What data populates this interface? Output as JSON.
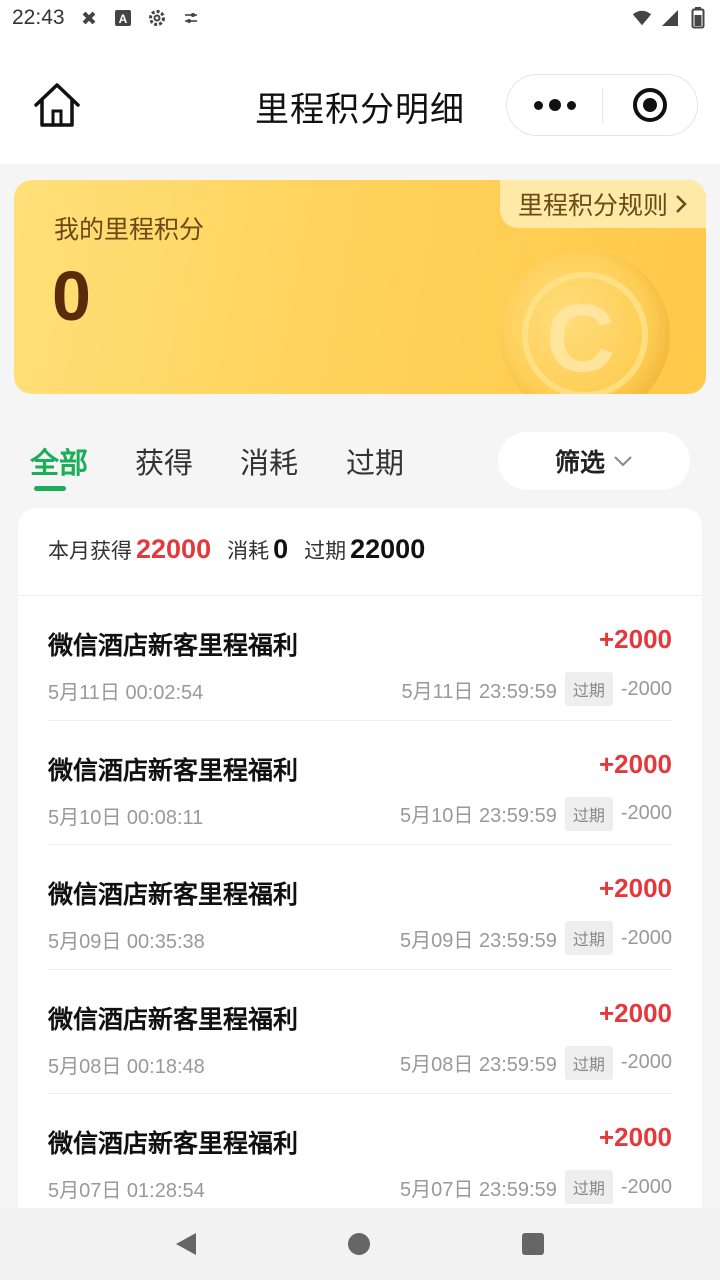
{
  "status_bar": {
    "time": "22:43"
  },
  "header": {
    "title": "里程积分明细"
  },
  "points_card": {
    "label": "我的里程积分",
    "value": "0",
    "rules_link": "里程积分规则"
  },
  "tabs": [
    {
      "label": "全部",
      "active": true
    },
    {
      "label": "获得",
      "active": false
    },
    {
      "label": "消耗",
      "active": false
    },
    {
      "label": "过期",
      "active": false
    }
  ],
  "filter": {
    "label": "筛选"
  },
  "summary": {
    "earned_label": "本月获得",
    "earned_value": "22000",
    "spent_label": "消耗",
    "spent_value": "0",
    "expired_label": "过期",
    "expired_value": "22000"
  },
  "records": [
    {
      "title": "微信酒店新客里程福利",
      "amount": "+2000",
      "time": "5月11日 00:02:54",
      "expire_time": "5月11日 23:59:59",
      "badge": "过期",
      "expire_amount": "-2000"
    },
    {
      "title": "微信酒店新客里程福利",
      "amount": "+2000",
      "time": "5月10日 00:08:11",
      "expire_time": "5月10日 23:59:59",
      "badge": "过期",
      "expire_amount": "-2000"
    },
    {
      "title": "微信酒店新客里程福利",
      "amount": "+2000",
      "time": "5月09日 00:35:38",
      "expire_time": "5月09日 23:59:59",
      "badge": "过期",
      "expire_amount": "-2000"
    },
    {
      "title": "微信酒店新客里程福利",
      "amount": "+2000",
      "time": "5月08日 00:18:48",
      "expire_time": "5月08日 23:59:59",
      "badge": "过期",
      "expire_amount": "-2000"
    },
    {
      "title": "微信酒店新客里程福利",
      "amount": "+2000",
      "time": "5月07日 01:28:54",
      "expire_time": "5月07日 23:59:59",
      "badge": "过期",
      "expire_amount": "-2000"
    }
  ],
  "colors": {
    "accent_green": "#1aad5a",
    "amount_red": "#e5383b",
    "card_gold": "#ffd35c"
  }
}
